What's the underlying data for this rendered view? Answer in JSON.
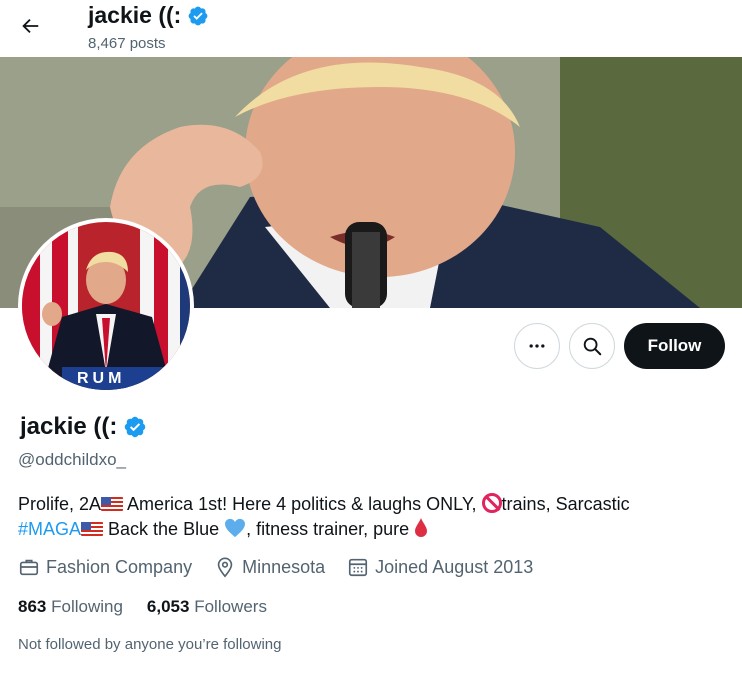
{
  "header": {
    "title": "jackie ((:",
    "post_count": "8,467 posts"
  },
  "profile": {
    "name": "jackie ((:",
    "handle": "@oddchildxo_",
    "bio": {
      "part1": "Prolife, 2A",
      "part2": " America 1st! Here 4 politics & laughs ONLY, ",
      "part3": "trains, Sarcastic",
      "hashtag": "#MAGA",
      "part4": " Back the Blue ",
      "part5": ", fitness trainer, pure "
    },
    "meta": {
      "category": "Fashion Company",
      "location": "Minnesota",
      "joined": "Joined August 2013"
    },
    "stats": {
      "following_count": "863",
      "following_label": "Following",
      "followers_count": "6,053",
      "followers_label": "Followers"
    },
    "not_followed_text": "Not followed by anyone you’re following",
    "avatar_banner_text": "RUM"
  },
  "actions": {
    "follow_label": "Follow"
  },
  "colors": {
    "accent": "#1d9bf0",
    "text": "#0f1419",
    "muted": "#536471",
    "follow_bg": "#0f1419"
  },
  "icons": {
    "back": "arrow-left-icon",
    "verified": "verified-badge-icon",
    "more": "more-horizontal-icon",
    "search": "search-icon",
    "category": "briefcase-icon",
    "location": "location-pin-icon",
    "calendar": "calendar-icon"
  }
}
